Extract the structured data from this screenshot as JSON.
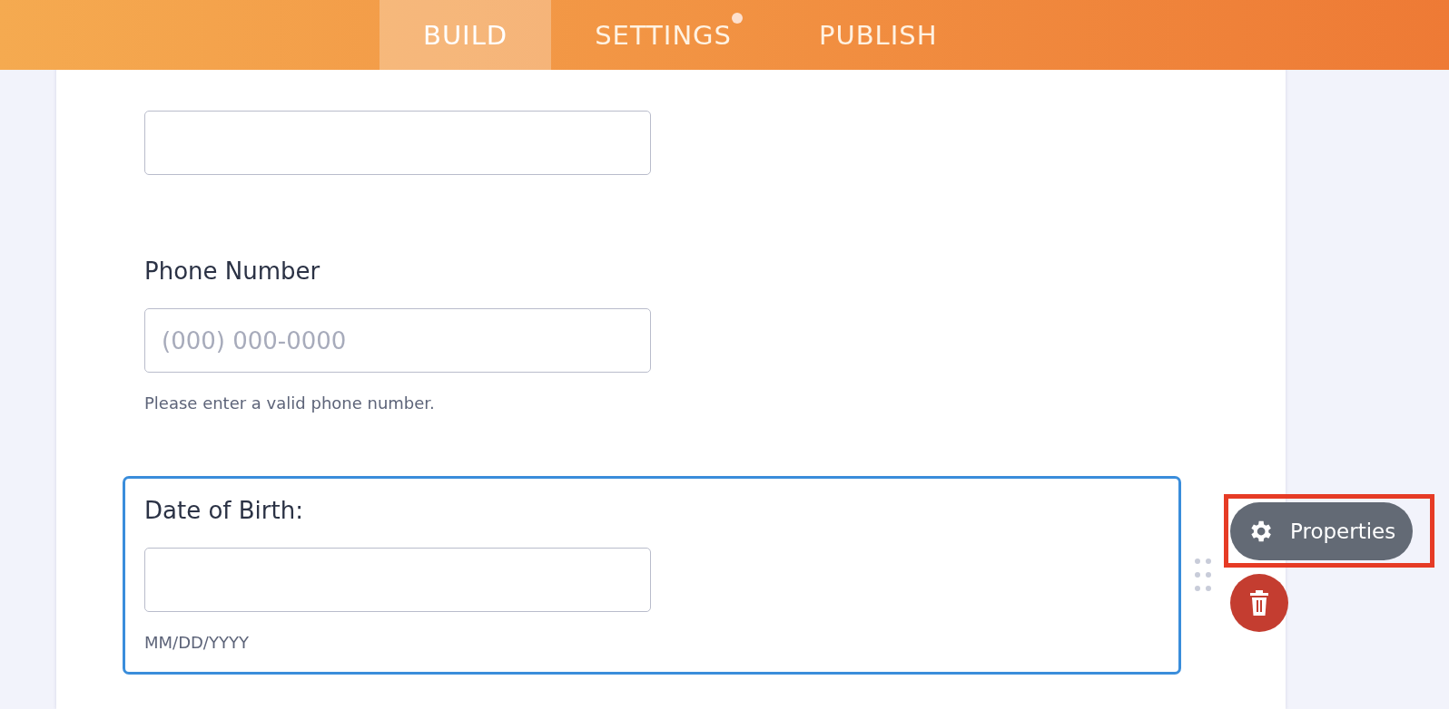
{
  "tabs": [
    {
      "label": "BUILD",
      "selected": true,
      "notification": false
    },
    {
      "label": "SETTINGS",
      "selected": false,
      "notification": true
    },
    {
      "label": "PUBLISH",
      "selected": false,
      "notification": false
    }
  ],
  "fields": [
    {
      "selected": false
    },
    {
      "label": "Phone Number",
      "placeholder": "(000) 000-0000",
      "helper": "Please enter a valid phone number.",
      "selected": false
    },
    {
      "label": "Date of Birth:",
      "helper": "MM/DD/YYYY",
      "selected": true
    }
  ],
  "field_toolbar": {
    "properties_button": "Properties",
    "highlighted": true
  }
}
